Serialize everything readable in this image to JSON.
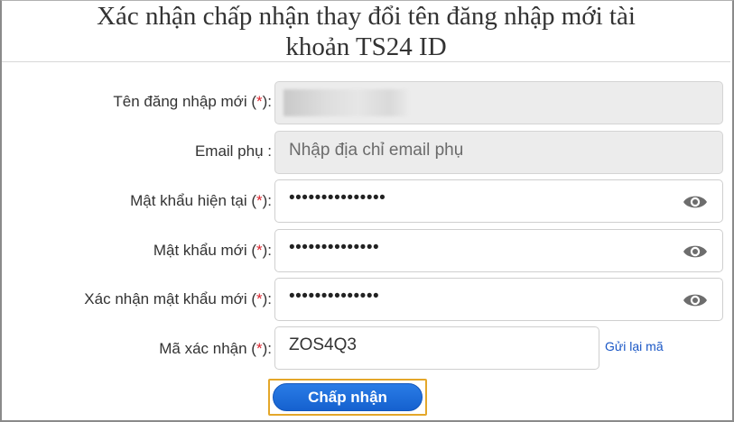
{
  "dialog": {
    "title_line1": "Xác nhận chấp nhận thay đổi tên đăng nhập mới tài",
    "title_line2": "khoản TS24 ID"
  },
  "form": {
    "new_username": {
      "label": "Tên đăng nhập mới (",
      "required_mark": "*",
      "label_suffix": "):",
      "value_redacted": true
    },
    "backup_email": {
      "label": "Email phụ :",
      "placeholder": "Nhập địa chỉ email phụ"
    },
    "current_password": {
      "label": "Mật khẩu hiện tại (",
      "required_mark": "*",
      "label_suffix": "):",
      "masked_value": "•••••••••••••••",
      "toggle_icon": "eye-icon"
    },
    "new_password": {
      "label": "Mật khẩu mới (",
      "required_mark": "*",
      "label_suffix": "):",
      "masked_value": "••••••••••••••",
      "toggle_icon": "eye-icon"
    },
    "confirm_password": {
      "label": "Xác nhận mật khẩu mới (",
      "required_mark": "*",
      "label_suffix": "):",
      "masked_value": "••••••••••••••",
      "toggle_icon": "eye-icon"
    },
    "verification_code": {
      "label": "Mã xác nhận (",
      "required_mark": "*",
      "label_suffix": "):",
      "value": "ZOS4Q3",
      "resend_label": "Gửi lại mã"
    },
    "submit_label": "Chấp nhận"
  },
  "colors": {
    "required": "#d9232d",
    "link": "#1a57c6",
    "button": "#1a6ad9",
    "highlight": "#e4a72a"
  }
}
